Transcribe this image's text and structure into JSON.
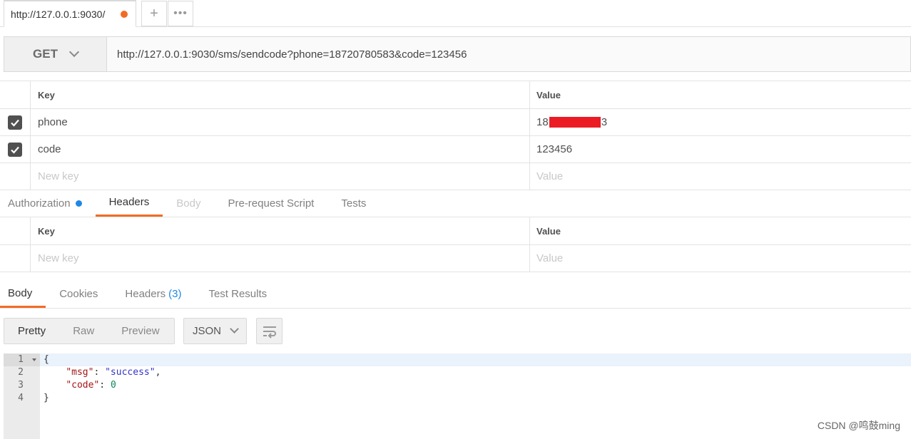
{
  "tabbar": {
    "active_tab_title": "http://127.0.0.1:9030/",
    "add_tab": "+",
    "more_tabs": "•••"
  },
  "request": {
    "method": "GET",
    "url": "http://127.0.0.1:9030/sms/sendcode?phone=18720780583&code=123456"
  },
  "params": {
    "header_key": "Key",
    "header_value": "Value",
    "rows": [
      {
        "checked": true,
        "key": "phone",
        "value_prefix": "18",
        "value_suffix": "3",
        "value_redacted": true
      },
      {
        "checked": true,
        "key": "code",
        "value": "123456"
      }
    ],
    "new_key_placeholder": "New key",
    "new_value_placeholder": "Value"
  },
  "request_tabs": [
    {
      "label": "Authorization",
      "state": "normal",
      "indicator": true
    },
    {
      "label": "Headers",
      "state": "active"
    },
    {
      "label": "Body",
      "state": "disabled"
    },
    {
      "label": "Pre-request Script",
      "state": "normal"
    },
    {
      "label": "Tests",
      "state": "normal"
    }
  ],
  "headers_table": {
    "header_key": "Key",
    "header_value": "Value",
    "new_key_placeholder": "New key",
    "new_value_placeholder": "Value"
  },
  "response_tabs": [
    {
      "label": "Body",
      "state": "active"
    },
    {
      "label": "Cookies",
      "state": "normal"
    },
    {
      "label": "Headers",
      "state": "normal",
      "count": "(3)"
    },
    {
      "label": "Test Results",
      "state": "normal"
    }
  ],
  "response_toolbar": {
    "modes": [
      "Pretty",
      "Raw",
      "Preview"
    ],
    "active_mode": "Pretty",
    "format": "JSON"
  },
  "response_body": {
    "line_numbers": [
      "1",
      "2",
      "3",
      "4"
    ],
    "open_brace": "{",
    "msg_key": "\"msg\"",
    "msg_value": "\"success\"",
    "code_key": "\"code\"",
    "code_value": "0",
    "close_brace": "}"
  },
  "colors": {
    "accent": "#f26b24",
    "info": "#1e88e5",
    "redaction": "#ec1c24"
  },
  "watermark": "CSDN @鸣鼓ming"
}
